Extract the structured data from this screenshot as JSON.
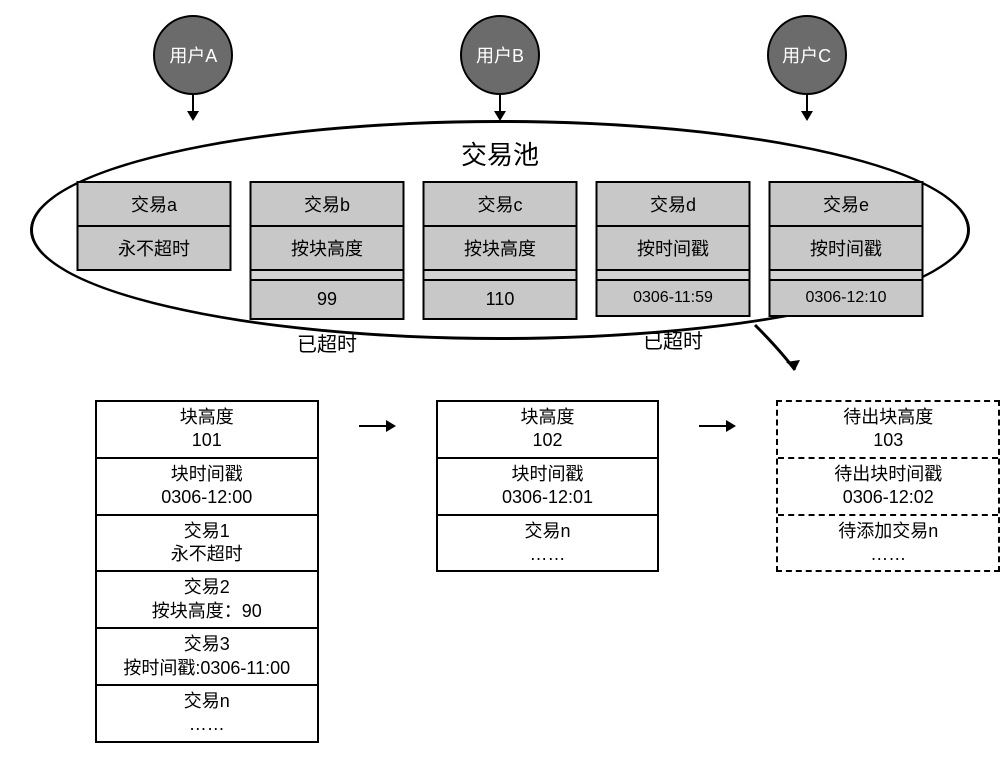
{
  "users": {
    "a": "用户A",
    "b": "用户B",
    "c": "用户C"
  },
  "pool": {
    "title": "交易池",
    "tx_a": {
      "name": "交易a",
      "mode": "永不超时"
    },
    "tx_b": {
      "name": "交易b",
      "mode": "按块高度",
      "value": "99",
      "status": "已超时"
    },
    "tx_c": {
      "name": "交易c",
      "mode": "按块高度",
      "value": "110"
    },
    "tx_d": {
      "name": "交易d",
      "mode": "按时间戳",
      "value": "0306-11:59",
      "status": "已超时"
    },
    "tx_e": {
      "name": "交易e",
      "mode": "按时间戳",
      "value": "0306-12:10"
    }
  },
  "blocks": {
    "b101": {
      "height": "块高度\n101",
      "ts": "块时间戳\n0306-12:00",
      "tx1": "交易1\n永不超时",
      "tx2": "交易2\n按块高度：90",
      "tx3": "交易3\n按时间戳:0306-11:00",
      "txn": "交易n\n……"
    },
    "b102": {
      "height": "块高度\n102",
      "ts": "块时间戳\n0306-12:01",
      "txn": "交易n\n……"
    },
    "b103": {
      "height": "待出块高度\n103",
      "ts": "待出块时间戳\n0306-12:02",
      "txn": "待添加交易n\n……"
    }
  }
}
